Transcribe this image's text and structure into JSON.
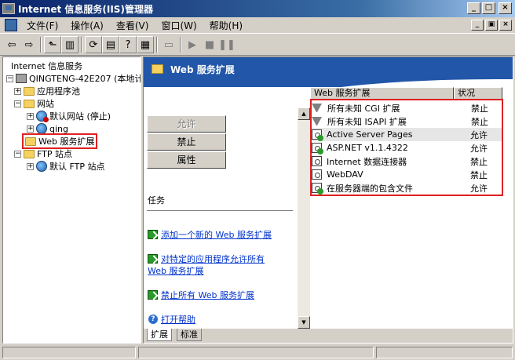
{
  "window": {
    "title": "Internet 信息服务(IIS)管理器",
    "minimize": "_",
    "maximize": "□",
    "close": "×"
  },
  "menu": {
    "items": [
      "文件(F)",
      "操作(A)",
      "查看(V)",
      "窗口(W)",
      "帮助(H)"
    ],
    "mdi_buttons": [
      "_",
      "▣",
      "×"
    ]
  },
  "toolbar": {
    "icons": [
      "back-arrow-icon",
      "forward-arrow-icon",
      "up-folder-icon",
      "show-hide-tree-icon",
      "refresh-icon",
      "export-list-icon",
      "help-icon",
      "properties-icon",
      "computer-icon",
      "play-icon",
      "stop-icon",
      "pause-icon"
    ]
  },
  "tree": {
    "root": "Internet 信息服务",
    "server": "QINGTENG-42E207 (本地计算",
    "app_pools": "应用程序池",
    "websites": "网站",
    "default_site": "默认网站 (停止)",
    "qing_site": "qing",
    "web_ext": "Web 服务扩展",
    "ftp_sites": "FTP 站点",
    "default_ftp": "默认 FTP 站点"
  },
  "panel": {
    "title": "Web 服务扩展",
    "btn_allow": "允许",
    "btn_deny": "禁止",
    "btn_props": "属性",
    "tasks_label": "任务",
    "task_add": "添加一个新的 Web 服务扩展",
    "task_allow_line1": "对特定的应用程序允许所有",
    "task_allow_line2": "Web 服务扩展",
    "task_deny_all": "禁止所有 Web 服务扩展",
    "task_help": "打开帮助"
  },
  "list": {
    "col_name": "Web 服务扩展",
    "col_status": "状况",
    "rows": [
      {
        "name": "所有未知 CGI 扩展",
        "status": "禁止",
        "icon": "filter-icon"
      },
      {
        "name": "所有未知 ISAPI 扩展",
        "status": "禁止",
        "icon": "filter-icon"
      },
      {
        "name": "Active Server Pages",
        "status": "允许",
        "icon": "extension-allowed-icon"
      },
      {
        "name": "ASP.NET v1.1.4322",
        "status": "允许",
        "icon": "extension-allowed-icon"
      },
      {
        "name": "Internet 数据连接器",
        "status": "禁止",
        "icon": "extension-icon"
      },
      {
        "name": "WebDAV",
        "status": "禁止",
        "icon": "extension-icon"
      },
      {
        "name": "在服务器端的包含文件",
        "status": "允许",
        "icon": "extension-allowed-icon"
      }
    ]
  },
  "tabs": {
    "extended": "扩展",
    "standard": "标准"
  },
  "colors": {
    "title_gradient_start": "#0a246a",
    "header_band": "#2256a8",
    "highlight_box": "#e02020",
    "link": "#0033cc"
  }
}
